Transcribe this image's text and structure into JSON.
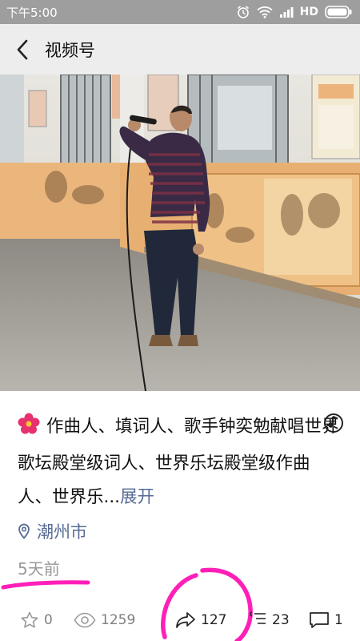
{
  "status_bar": {
    "time": "下午5:00",
    "network": "HD",
    "icons": [
      "alarm-icon",
      "wifi-icon",
      "signal-icon",
      "battery-icon"
    ]
  },
  "header": {
    "title": "视频号",
    "back_icon": "back-arrow-icon"
  },
  "post": {
    "emoji": "hibiscus-flower",
    "text": "作曲人、填词人、歌手钟奕勉献唱世界歌坛殿堂级词人、世界乐坛殿堂级作曲人、世界乐...",
    "expand_label": "展开",
    "location": "潮州市",
    "time_ago": "5天前"
  },
  "actions": {
    "likes": "0",
    "views": "1259",
    "shares": "127",
    "favorites": "23",
    "comments": "1"
  },
  "colors": {
    "link": "#576b95",
    "annotation": "#ff1fb8",
    "status_bar": "#9e9e9e",
    "header": "#ededed"
  }
}
